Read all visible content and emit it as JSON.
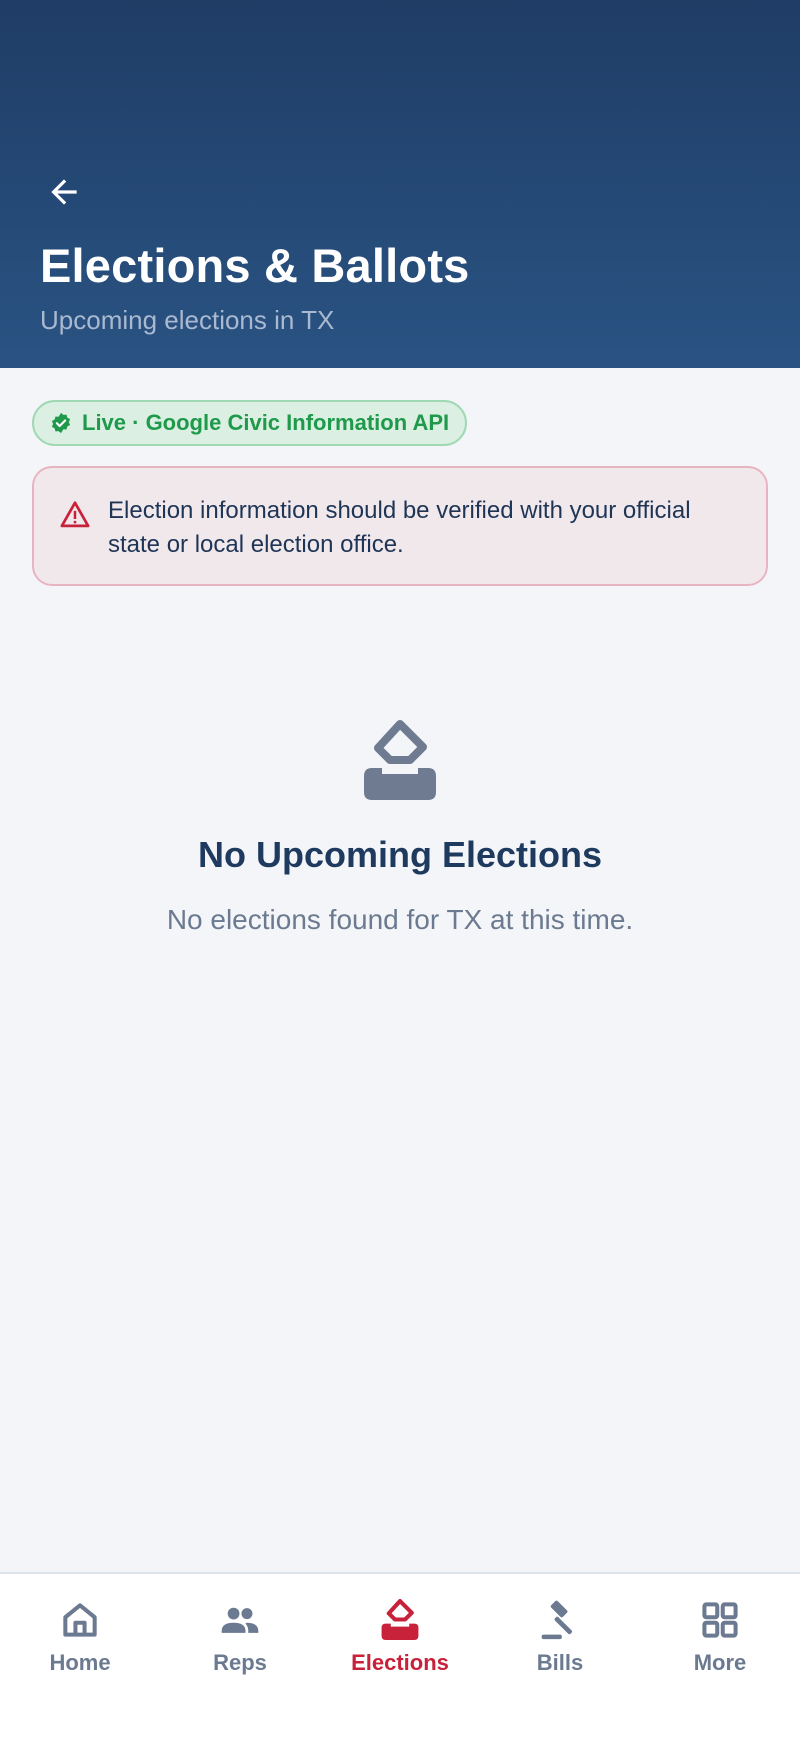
{
  "header": {
    "title": "Elections & Ballots",
    "subtitle": "Upcoming elections in TX",
    "back_icon": "arrow-left-icon"
  },
  "source_badge": {
    "label": "Live · Google Civic Information API",
    "icon": "verified-check-icon",
    "color": "#1f9a4b"
  },
  "notice": {
    "icon": "warning-triangle-icon",
    "text": "Election information should be verified with your official state or local election office.",
    "accent": "#c8213a"
  },
  "empty_state": {
    "icon": "ballot-box-icon",
    "title": "No Upcoming Elections",
    "message": "No elections found for TX at this time."
  },
  "bottom_nav": {
    "active": "Elections",
    "active_color": "#c8213a",
    "items": [
      {
        "label": "Home",
        "icon": "home-icon"
      },
      {
        "label": "Reps",
        "icon": "people-icon"
      },
      {
        "label": "Elections",
        "icon": "ballot-icon"
      },
      {
        "label": "Bills",
        "icon": "gavel-icon"
      },
      {
        "label": "More",
        "icon": "grid-icon"
      }
    ]
  }
}
